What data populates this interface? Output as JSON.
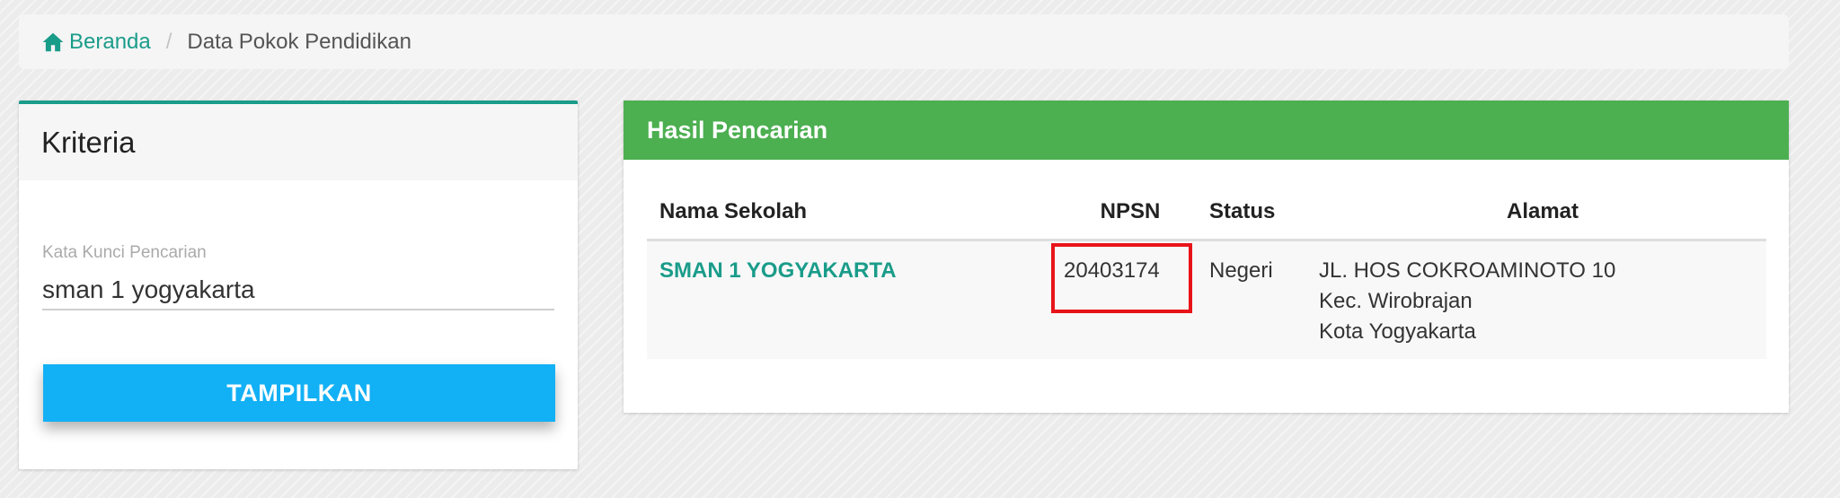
{
  "breadcrumb": {
    "home_label": "Beranda",
    "separator": "/",
    "current": "Data Pokok Pendidikan"
  },
  "criteria": {
    "title": "Kriteria",
    "search_label": "Kata Kunci Pencarian",
    "search_value": "sman 1 yogyakarta",
    "button_label": "TAMPILKAN"
  },
  "results": {
    "title": "Hasil Pencarian",
    "columns": {
      "name": "Nama Sekolah",
      "npsn": "NPSN",
      "status": "Status",
      "address": "Alamat"
    },
    "rows": [
      {
        "name": "SMAN 1 YOGYAKARTA",
        "npsn": "20403174",
        "status": "Negeri",
        "address_lines": [
          "JL. HOS COKROAMINOTO 10",
          "Kec. Wirobrajan",
          "Kota Yogyakarta"
        ]
      }
    ]
  },
  "colors": {
    "accent_teal": "#1a9c8a",
    "header_green": "#4caf50",
    "button_blue": "#12b0f5",
    "highlight_red": "#e8141a"
  }
}
